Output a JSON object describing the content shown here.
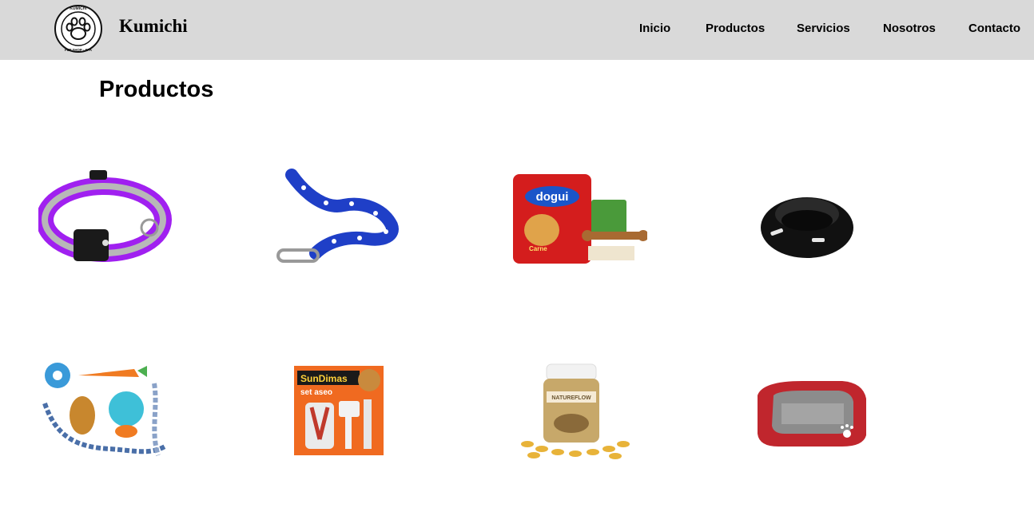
{
  "header": {
    "brand": "Kumichi",
    "logo": {
      "icon": "paw-print-icon",
      "ring_top_text": "KUMICHI",
      "ring_bottom_text": "PET SHOP - SPA"
    },
    "nav": [
      {
        "label": "Inicio"
      },
      {
        "label": "Productos"
      },
      {
        "label": "Servicios"
      },
      {
        "label": "Nosotros"
      },
      {
        "label": "Contacto"
      }
    ]
  },
  "main": {
    "title": "Productos",
    "products": [
      {
        "icon": "dog-collar-image"
      },
      {
        "icon": "dog-leash-image"
      },
      {
        "icon": "dog-food-bag-image",
        "package_text": "dogui",
        "package_subtext": "Carne"
      },
      {
        "icon": "pet-bowl-image"
      },
      {
        "icon": "dog-toys-image"
      },
      {
        "icon": "grooming-kit-image",
        "package_text": "SunDimas",
        "package_subtext": "set aseo"
      },
      {
        "icon": "supplement-jar-image",
        "package_text": "NATUREFLOW"
      },
      {
        "icon": "pet-bed-image"
      }
    ]
  },
  "colors": {
    "navbar_bg": "#d9d9d9",
    "text": "#000000"
  }
}
